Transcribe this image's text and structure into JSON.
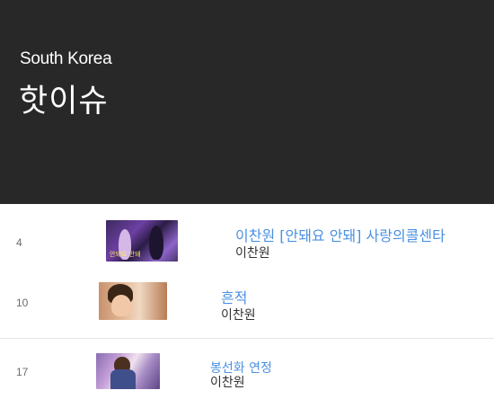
{
  "header": {
    "country": "South Korea",
    "title": "핫이슈"
  },
  "rows": [
    {
      "rank": "4",
      "title": "이찬원 [안돼요 안돼] 사랑의콜센타",
      "artist": "이찬원",
      "thumb_caption": "안돼요 안돼"
    },
    {
      "rank": "10",
      "title": "흔적",
      "artist": "이찬원"
    },
    {
      "rank": "17",
      "title": "봉선화 연정",
      "artist": "이찬원"
    }
  ],
  "colors": {
    "header_bg": "#282828",
    "title_link": "#4a90e2"
  }
}
